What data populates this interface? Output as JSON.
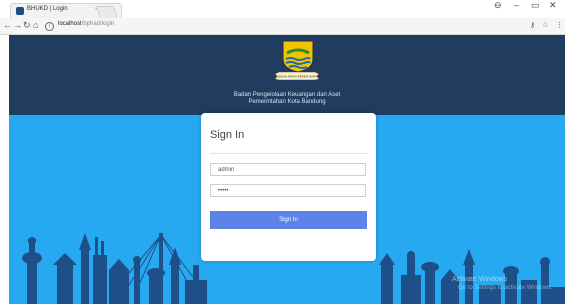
{
  "browser": {
    "tab_title": "BHUKD | Login",
    "tab_close": "×",
    "url_host": "localhost",
    "url_path": "/bphad/login",
    "min": "–",
    "restore": "▭",
    "close": "✕",
    "account": "⊖"
  },
  "header": {
    "logo_text": "GEMAH RIPAH REPEH RAPIH",
    "org_line1": "Badan Pengelolaan Keuangan dan Aset",
    "org_line2": "Pemerintahan Kota Bandung"
  },
  "login": {
    "title": "Sign In",
    "username_value": "admin",
    "password_value": "•••••",
    "button_label": "Sign In"
  },
  "watermark": {
    "line1": "Activate Windows",
    "line2": "Go to Settings to activate Windows."
  },
  "colors": {
    "header_bg": "#203d60",
    "content_bg": "#27a9f1",
    "button_bg": "#5e83e6"
  }
}
